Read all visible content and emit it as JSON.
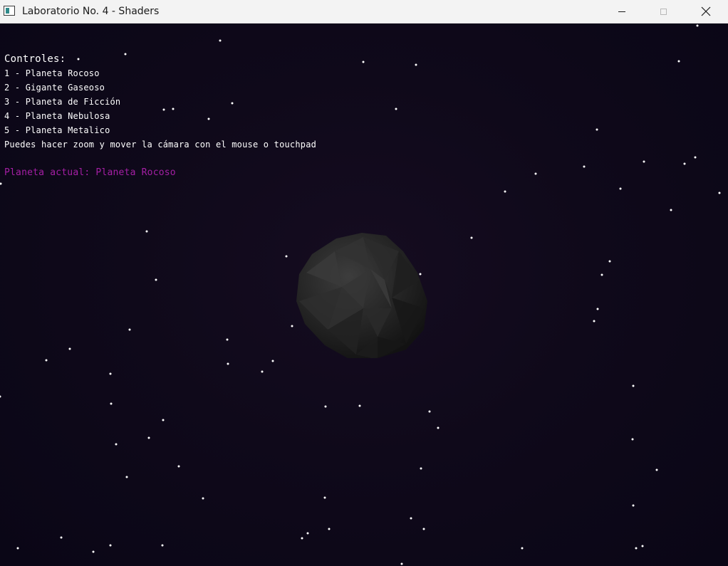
{
  "window": {
    "title": "Laboratorio No. 4 - Shaders",
    "icon": "app-window-icon",
    "controls": [
      "minimize-icon",
      "maximize-icon",
      "close-icon"
    ]
  },
  "hud": {
    "heading": "Controles:",
    "controls": [
      "1 - Planeta Rocoso",
      "2 - Gigante Gaseoso",
      "3 - Planeta de Ficción",
      "4 - Planeta Nebulosa",
      "5 - Planeta Metalico"
    ],
    "hint": "Puedes hacer zoom y mover la cámara con el mouse o touchpad",
    "current_planet": "Planeta actual: Planeta Rocoso"
  },
  "colors": {
    "background": "#0f091a",
    "hud_text": "#ffffff",
    "current_planet_text": "#a51fa5",
    "planet": "#2a2a2a"
  }
}
